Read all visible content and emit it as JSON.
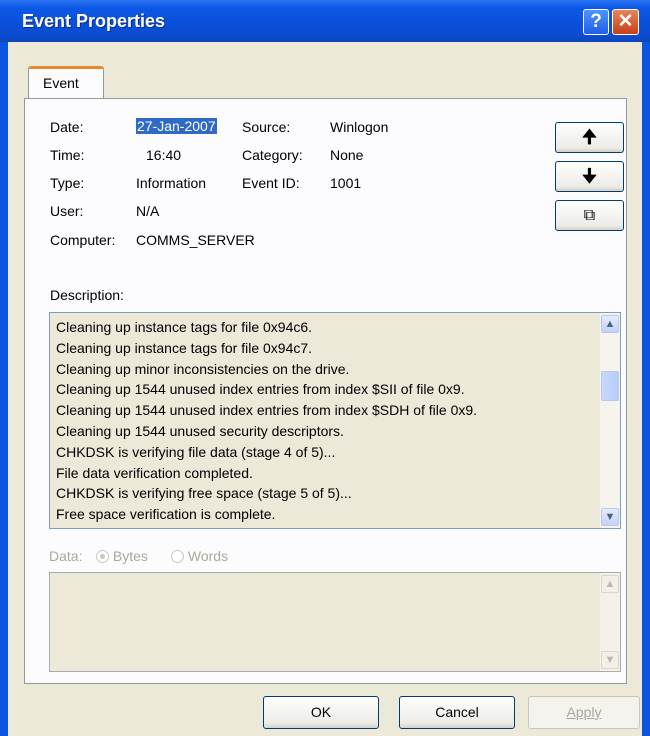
{
  "window": {
    "title": "Event Properties",
    "help_glyph": "?",
    "close_glyph": "✕"
  },
  "tabs": [
    {
      "label": "Event"
    }
  ],
  "event": {
    "date_label": "Date:",
    "date_value": "27-Jan-2007",
    "source_label": "Source:",
    "source_value": "Winlogon",
    "time_label": "Time:",
    "time_value": "16:40",
    "category_label": "Category:",
    "category_value": "None",
    "type_label": "Type:",
    "type_value": "Information",
    "eventid_label": "Event ID:",
    "eventid_value": "1001",
    "user_label": "User:",
    "user_value": "N/A",
    "computer_label": "Computer:",
    "computer_value": "COMMS_SERVER"
  },
  "nav_buttons": {
    "up_glyph": "🠉",
    "down_glyph": "🠋",
    "copy_glyph": "⧉"
  },
  "description": {
    "label": "Description:",
    "lines": [
      "Cleaning up instance tags for file 0x94c6.",
      "Cleaning up instance tags for file 0x94c7.",
      "Cleaning up minor inconsistencies on the drive.",
      "Cleaning up 1544 unused index entries from index $SII of file 0x9.",
      "Cleaning up 1544 unused index entries from index $SDH of file 0x9.",
      "Cleaning up 1544 unused security descriptors.",
      "CHKDSK is verifying file data (stage 4 of 5)...",
      "File data verification completed.",
      "CHKDSK is verifying free space (stage 5 of 5)...",
      "Free space verification is complete."
    ]
  },
  "data_section": {
    "label": "Data:",
    "bytes_label": "Bytes",
    "words_label": "Words",
    "selected": "Bytes"
  },
  "buttons": {
    "ok": "OK",
    "cancel": "Cancel",
    "apply": "Apply"
  },
  "colors": {
    "title_bar": "#0b54e0",
    "dialog_bg": "#ece9d8",
    "selection": "#316ac5",
    "tab_accent": "#e68b2c"
  }
}
